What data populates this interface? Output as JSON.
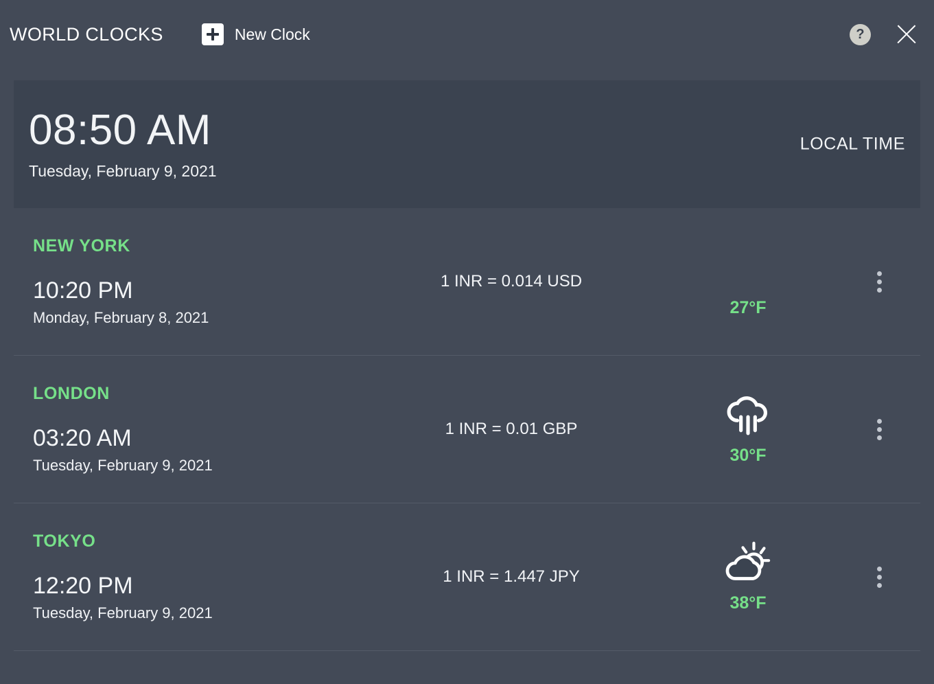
{
  "header": {
    "app_title": "WORLD CLOCKS",
    "new_clock_label": "New Clock",
    "help_label": "?",
    "help_icon": "help-circle-icon",
    "close_icon": "close-icon",
    "plus_icon": "plus-icon"
  },
  "local": {
    "time": "08:50 AM",
    "date": "Tuesday, February 9, 2021",
    "label": "LOCAL TIME"
  },
  "colors": {
    "page_bg": "#434a57",
    "panel_bg": "#3b4350",
    "accent_green": "#76e089",
    "text": "#f2f4f6",
    "divider": "#545b68"
  },
  "clocks": [
    {
      "city": "NEW YORK",
      "time": "10:20 PM",
      "date": "Monday, February 8, 2021",
      "currency": "1 INR = 0.014 USD",
      "temperature": "27°F",
      "weather_icon": "crescent-moon-icon",
      "menu_icon": "more-vertical-icon"
    },
    {
      "city": "LONDON",
      "time": "03:20 AM",
      "date": "Tuesday, February 9, 2021",
      "currency": "1 INR = 0.01 GBP",
      "temperature": "30°F",
      "weather_icon": "rain-cloud-icon",
      "menu_icon": "more-vertical-icon"
    },
    {
      "city": "TOKYO",
      "time": "12:20 PM",
      "date": "Tuesday, February 9, 2021",
      "currency": "1 INR = 1.447 JPY",
      "temperature": "38°F",
      "weather_icon": "sun-behind-cloud-icon",
      "menu_icon": "more-vertical-icon"
    }
  ]
}
